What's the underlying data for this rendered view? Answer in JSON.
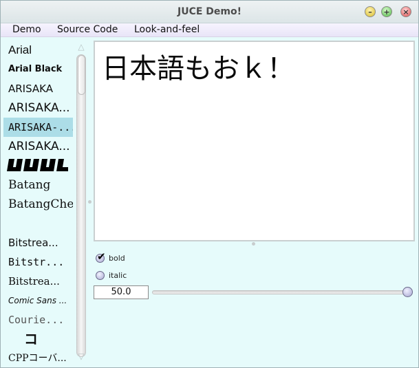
{
  "window": {
    "title": "JUCE Demo!",
    "controls": {
      "minimize": "–",
      "maximize": "+",
      "close": "×"
    }
  },
  "menu": [
    "Demo",
    "Source Code",
    "Look-and-feel"
  ],
  "font_list": {
    "items": [
      "Arial",
      "Arial Black",
      "ARISAKA",
      "ARISAKA...",
      "ARISAKA-...",
      "ARISAKA...",
      "ILILIL",
      "Batang",
      "BatangChe",
      "",
      "Bitstrea...",
      "Bitstr...",
      "Bitstrea...",
      "Comic Sans ...",
      "Courie...",
      "コ",
      "CPPコーバ..."
    ],
    "selected_index": 4
  },
  "preview": {
    "text": "日本語もおｋ！"
  },
  "options": {
    "bold_label": "bold",
    "bold_checked": true,
    "italic_label": "italic",
    "italic_checked": false
  },
  "size": {
    "value": "50.0",
    "slider_fraction": 1.0
  },
  "colors": {
    "background": "#e6fbfb",
    "selection": "#acdde7",
    "preview_bg": "#ffffff"
  },
  "icons": {
    "scroll_up": "scroll-up-arrow-icon",
    "scroll_down": "scroll-down-arrow-icon",
    "checkmark": "checkmark-icon"
  }
}
